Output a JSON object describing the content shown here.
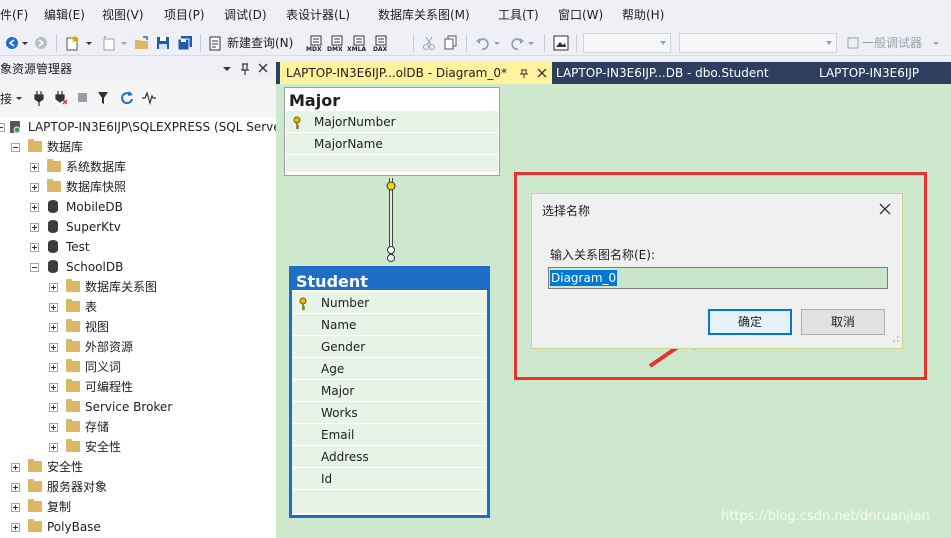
{
  "menu": [
    "件(F)",
    "编辑(E)",
    "视图(V)",
    "项目(P)",
    "调试(D)",
    "表设计器(L)",
    "数据库关系图(M)",
    "工具(T)",
    "窗口(W)",
    "帮助(H)"
  ],
  "toolbar": {
    "new_query": "新建查询(N)",
    "general_debugger": "一般调试器",
    "icons": [
      "back-icon",
      "forward-icon",
      "new-project-icon",
      "add-item-icon",
      "open-icon",
      "save-icon",
      "save-all-icon",
      "mdx-query-icon",
      "dmx-query-icon",
      "xmla-query-icon",
      "dax-query-icon",
      "cut-icon",
      "copy-icon",
      "undo-icon",
      "redo-icon",
      "screenshot-icon"
    ],
    "query_labels": [
      "MDX",
      "DMX",
      "XMLA",
      "DAX"
    ]
  },
  "object_explorer": {
    "title": "象资源管理器",
    "connect_label": "接",
    "tree": [
      {
        "label": "LAPTOP-IN3E6IJP\\SQLEXPRESS (SQL Serve",
        "icon": "server-icon"
      },
      {
        "label": "数据库",
        "icon": "folder-icon"
      },
      {
        "label": "系统数据库",
        "icon": "folder-icon"
      },
      {
        "label": "数据库快照",
        "icon": "folder-icon"
      },
      {
        "label": "MobileDB",
        "icon": "database-icon"
      },
      {
        "label": "SuperKtv",
        "icon": "database-icon"
      },
      {
        "label": "Test",
        "icon": "database-icon"
      },
      {
        "label": "SchoolDB",
        "icon": "database-icon"
      },
      {
        "label": "数据库关系图",
        "icon": "folder-icon"
      },
      {
        "label": "表",
        "icon": "folder-icon"
      },
      {
        "label": "视图",
        "icon": "folder-icon"
      },
      {
        "label": "外部资源",
        "icon": "folder-icon"
      },
      {
        "label": "同义词",
        "icon": "folder-icon"
      },
      {
        "label": "可编程性",
        "icon": "folder-icon"
      },
      {
        "label": "Service Broker",
        "icon": "folder-icon"
      },
      {
        "label": "存储",
        "icon": "folder-icon"
      },
      {
        "label": "安全性",
        "icon": "folder-icon"
      },
      {
        "label": "安全性",
        "icon": "folder-icon"
      },
      {
        "label": "服务器对象",
        "icon": "folder-icon"
      },
      {
        "label": "复制",
        "icon": "folder-icon"
      },
      {
        "label": "PolyBase",
        "icon": "folder-icon"
      }
    ]
  },
  "tabs": [
    {
      "label": "LAPTOP-IN3E6IJP...olDB - Diagram_0*",
      "active": true
    },
    {
      "label": "LAPTOP-IN3E6IJP...DB - dbo.Student",
      "active": false
    },
    {
      "label": "LAPTOP-IN3E6IJP",
      "active": false
    }
  ],
  "diagram": {
    "major": {
      "title": "Major",
      "columns": [
        "MajorNumber",
        "MajorName"
      ]
    },
    "student": {
      "title": "Student",
      "columns": [
        "Number",
        "Name",
        "Gender",
        "Age",
        "Major",
        "Works",
        "Email",
        "Address",
        "Id"
      ]
    }
  },
  "dialog": {
    "title": "选择名称",
    "label": "输入关系图名称(E):",
    "input_value": "Diagram_0",
    "ok": "确定",
    "cancel": "取消"
  },
  "watermark": "https://blog.csdn.net/dnruanjian",
  "colors": {
    "designer_bg": "#cde8cd",
    "tab_active": "#fff29d",
    "tab_bar": "#2d3e5e",
    "selection": "#0078d7",
    "annotation": "#e8322e"
  }
}
